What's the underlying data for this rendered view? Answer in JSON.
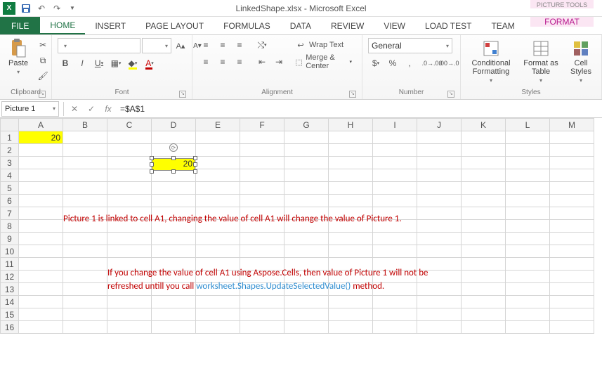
{
  "qat": {
    "title": "LinkedShape.xlsx - Microsoft Excel",
    "contextual_tools_label": "PICTURE TOOLS"
  },
  "tabs": {
    "file": "FILE",
    "home": "HOME",
    "insert": "INSERT",
    "page_layout": "PAGE LAYOUT",
    "formulas": "FORMULAS",
    "data": "DATA",
    "review": "REVIEW",
    "view": "VIEW",
    "load_test": "LOAD TEST",
    "team": "TEAM",
    "format": "FORMAT"
  },
  "ribbon": {
    "clipboard": {
      "title": "Clipboard",
      "paste": "Paste"
    },
    "font": {
      "title": "Font",
      "name_placeholder": "",
      "size_placeholder": "",
      "bold": "B",
      "italic": "I",
      "underline": "U"
    },
    "alignment": {
      "title": "Alignment",
      "wrap": "Wrap Text",
      "merge": "Merge & Center"
    },
    "number": {
      "title": "Number",
      "format": "General",
      "currency": "$",
      "percent": "%",
      "comma": ","
    },
    "styles": {
      "title": "Styles",
      "cond": "Conditional Formatting",
      "table": "Format as Table",
      "cell": "Cell Styles"
    }
  },
  "formula_bar": {
    "name": "Picture 1",
    "formula": "=$A$1",
    "fx": "fx"
  },
  "grid": {
    "cols": [
      "A",
      "B",
      "C",
      "D",
      "E",
      "F",
      "G",
      "H",
      "I",
      "J",
      "K",
      "L",
      "M"
    ],
    "rows": 16,
    "a1": "20",
    "picture_value": "20"
  },
  "annotations": {
    "text1": "Picture 1 is linked to cell A1, changing the value of cell A1 will change the value of Picture 1.",
    "text2a": "If you change the value of cell A1 using Aspose.Cells, then value of Picture 1 will not be refreshed untill you call ",
    "text2b": "worksheet.Shapes.UpdateSelectedValue()",
    "text2c": " method."
  }
}
